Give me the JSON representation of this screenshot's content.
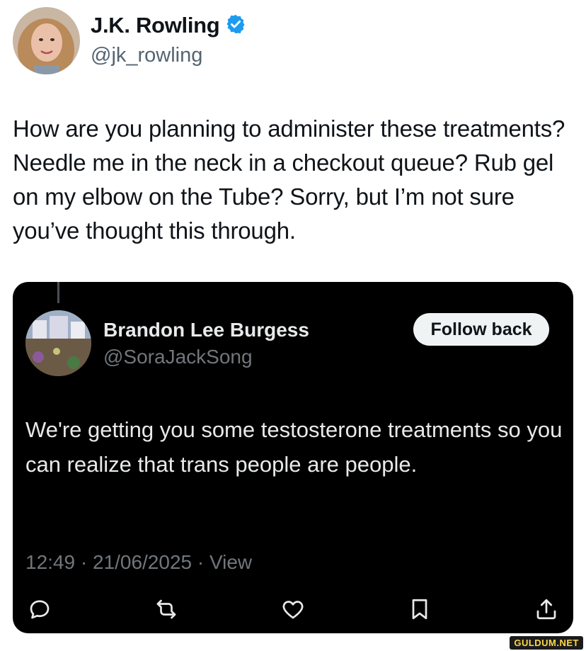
{
  "author": {
    "name": "J.K. Rowling",
    "handle": "@jk_rowling",
    "verified": true
  },
  "tweet": {
    "text": "How are you planning to administer these treatments? Needle me in the neck in a checkout queue? Rub gel on my elbow on the Tube? Sorry, but I’m not sure you’ve thought this through."
  },
  "quoted": {
    "name": "Brandon Lee Burgess",
    "handle": "@SoraJackSong",
    "follow_label": "Follow back",
    "text": "We're getting you some testosterone treatments so you can realize that trans people are people.",
    "meta": "12:49 · 21/06/2025 · View"
  },
  "actions": [
    "reply-icon",
    "retweet-icon",
    "like-icon",
    "bookmark-icon",
    "share-icon"
  ],
  "watermark": "GULDUM.NET",
  "colors": {
    "verified": "#1d9bf0",
    "card_bg": "#000000",
    "muted": "#71767b",
    "text_dark": "#0f1419"
  }
}
